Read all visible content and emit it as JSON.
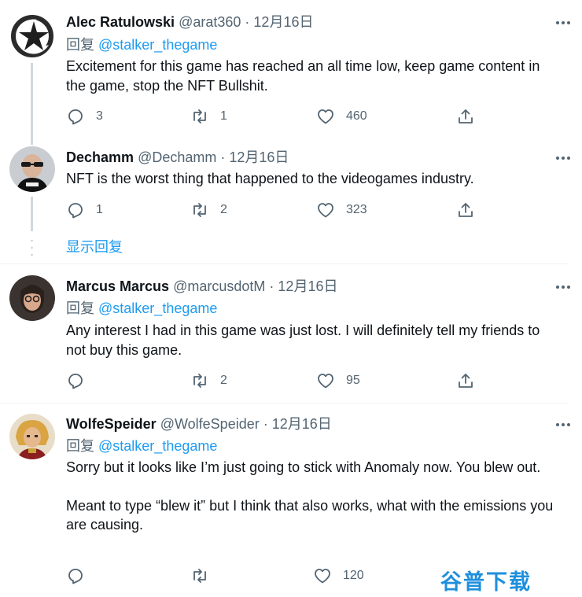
{
  "tweets": [
    {
      "name": "Alec Ratulowski",
      "handle": "@arat360",
      "dot": "·",
      "date": "12月16日",
      "reply_prefix": "回复",
      "reply_mention": "@stalker_thegame",
      "text": [
        "Excitement for this game has reached an all time low, keep game content in the game, stop the NFT Bullshit."
      ],
      "replies": "3",
      "retweets": "1",
      "likes": "460"
    },
    {
      "name": "Dechamm",
      "handle": "@Dechamm",
      "dot": "·",
      "date": "12月16日",
      "text": [
        "NFT is the worst thing that happened to the videogames industry."
      ],
      "replies": "1",
      "retweets": "2",
      "likes": "323"
    },
    {
      "name": "Marcus Marcus",
      "handle": "@marcusdotM",
      "dot": "·",
      "date": "12月16日",
      "reply_prefix": "回复",
      "reply_mention": "@stalker_thegame",
      "text": [
        "Any interest I had in this game was just lost. I will definitely tell my friends to not buy this game."
      ],
      "replies": "",
      "retweets": "2",
      "likes": "95"
    },
    {
      "name": "WolfeSpeider",
      "handle": "@WolfeSpeider",
      "dot": "·",
      "date": "12月16日",
      "reply_prefix": "回复",
      "reply_mention": "@stalker_thegame",
      "text": [
        "Sorry but it looks like I’m just going to stick with Anomaly now. You blew out.",
        "Meant to type “blew it” but I think that also works, what with the emissions you are causing."
      ],
      "replies": "",
      "retweets": "",
      "likes": "120"
    }
  ],
  "show_replies_label": "显示回复",
  "watermark": "谷普下载",
  "colors": {
    "link": "#1d9bf0",
    "secondary_text": "#536471",
    "thread_line": "#cfd9de",
    "divider": "#eff3f4"
  }
}
